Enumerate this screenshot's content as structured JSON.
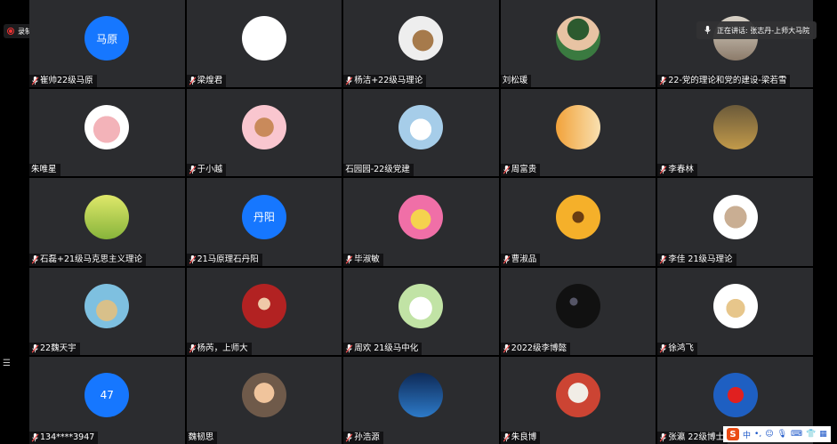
{
  "recording": {
    "label": "录制中"
  },
  "speaking": {
    "label": "正在讲话: 张志丹-上师大马院"
  },
  "ime": {
    "brand": "S",
    "mode": "中",
    "punct": "•,"
  },
  "colors": {
    "tile_bg": "#2b2c2f",
    "blue_avatar": "#1677ff",
    "muted": "#ff5555"
  },
  "participants": [
    {
      "name": "崔帅22级马原",
      "avatar_text": "马原",
      "avatar_bg": "#1677ff",
      "muted": true
    },
    {
      "name": "梁煌君",
      "avatar_text": "",
      "avatar_bg": "#ffffff",
      "muted": true
    },
    {
      "name": "杨洁+22级马理论",
      "avatar_text": "",
      "avatar_bg": "radial-gradient(circle at 55% 55%, #a67a4b 0 30%, #eee 31% 100%)",
      "muted": true
    },
    {
      "name": "刘松瑗",
      "avatar_text": "",
      "avatar_bg": "radial-gradient(circle at 50% 30%, #2c5a2f 0 28%, #e8c3a3 29% 55%, #3a7a40 56% 100%)",
      "muted": false
    },
    {
      "name": "22-党的理论和党的建设-梁若雪",
      "avatar_text": "",
      "avatar_bg": "linear-gradient(#d9d3c8,#8c7b6a)",
      "muted": true
    },
    {
      "name": "朱唯星",
      "avatar_text": "",
      "avatar_bg": "radial-gradient(circle at 50% 55%, #f3b3b9 0 40%, #fff 41% 100%)",
      "muted": false
    },
    {
      "name": "于小越",
      "avatar_text": "",
      "avatar_bg": "radial-gradient(circle at 50% 50%, #c98a5b 0 30%, #f9c6cf 31% 100%)",
      "muted": true
    },
    {
      "name": "石园园-22级党建",
      "avatar_text": "",
      "avatar_bg": "radial-gradient(circle at 50% 55%, #ffffff 0 32%, #a6cde9 33% 100%)",
      "muted": false
    },
    {
      "name": "周富贵",
      "avatar_text": "",
      "avatar_bg": "linear-gradient(90deg,#f2a23a,#f8e0b0)",
      "muted": true
    },
    {
      "name": "李春林",
      "avatar_text": "",
      "avatar_bg": "linear-gradient(#6b5a3a,#c29a4a)",
      "muted": true
    },
    {
      "name": "石磊+21级马克思主义理论",
      "avatar_text": "",
      "avatar_bg": "linear-gradient(#dfe86a,#87b43b)",
      "muted": true
    },
    {
      "name": "21马原理石丹阳",
      "avatar_text": "丹阳",
      "avatar_bg": "#1677ff",
      "muted": true
    },
    {
      "name": "毕淑敏",
      "avatar_text": "",
      "avatar_bg": "radial-gradient(circle at 50% 55%, #f5d24e 0 30%, #f06fa7 31% 100%)",
      "muted": true
    },
    {
      "name": "曹淑品",
      "avatar_text": "",
      "avatar_bg": "radial-gradient(circle at 50% 50%, #6a3d12 0 18%, #f5b02a 19% 100%)",
      "muted": true
    },
    {
      "name": "李佳 21级马理论",
      "avatar_text": "",
      "avatar_bg": "radial-gradient(circle at 50% 50%, #c9ae93 0 35%, #fff 36% 100%)",
      "muted": true
    },
    {
      "name": "22魏天宇",
      "avatar_text": "",
      "avatar_bg": "radial-gradient(circle at 50% 60%, #d8c08a 0 30%, #7ec0e0 31% 100%)",
      "muted": true
    },
    {
      "name": "杨芮，上师大",
      "avatar_text": "",
      "avatar_bg": "radial-gradient(circle at 50% 45%, #efc9a8 0 18%, #b22222 19% 100%)",
      "muted": true
    },
    {
      "name": "周欢 21级马中化",
      "avatar_text": "",
      "avatar_bg": "radial-gradient(circle at 50% 55%, #ffffff 0 34%, #c1e3a5 35% 100%)",
      "muted": true
    },
    {
      "name": "2022级李博懿",
      "avatar_text": "",
      "avatar_bg": "radial-gradient(circle at 40% 40%, #556 0 10%, #111 11% 100%)",
      "muted": true
    },
    {
      "name": "徐鸿飞",
      "avatar_text": "",
      "avatar_bg": "radial-gradient(circle at 50% 55%, #e7c68b 0 28%, #fff 29% 100%)",
      "muted": true
    },
    {
      "name": "134****3947",
      "avatar_text": "47",
      "avatar_bg": "#1677ff",
      "muted": true
    },
    {
      "name": "魏韧思",
      "avatar_text": "",
      "avatar_bg": "radial-gradient(circle at 50% 45%, #f0c49c 0 30%, #6f5a4a 31% 100%)",
      "muted": false
    },
    {
      "name": "孙浩源",
      "avatar_text": "",
      "avatar_bg": "linear-gradient(#0e2a57,#2d7ac8)",
      "muted": true
    },
    {
      "name": "朱良博",
      "avatar_text": "",
      "avatar_bg": "radial-gradient(circle at 50% 45%, #f1ede6 0 30%, #c43 31% 100%)",
      "muted": true
    },
    {
      "name": "张瀛 22级博士",
      "avatar_text": "",
      "avatar_bg": "radial-gradient(circle at 50% 50%, #e02020 0 25%, #1e5fc2 26% 100%)",
      "muted": true
    }
  ]
}
